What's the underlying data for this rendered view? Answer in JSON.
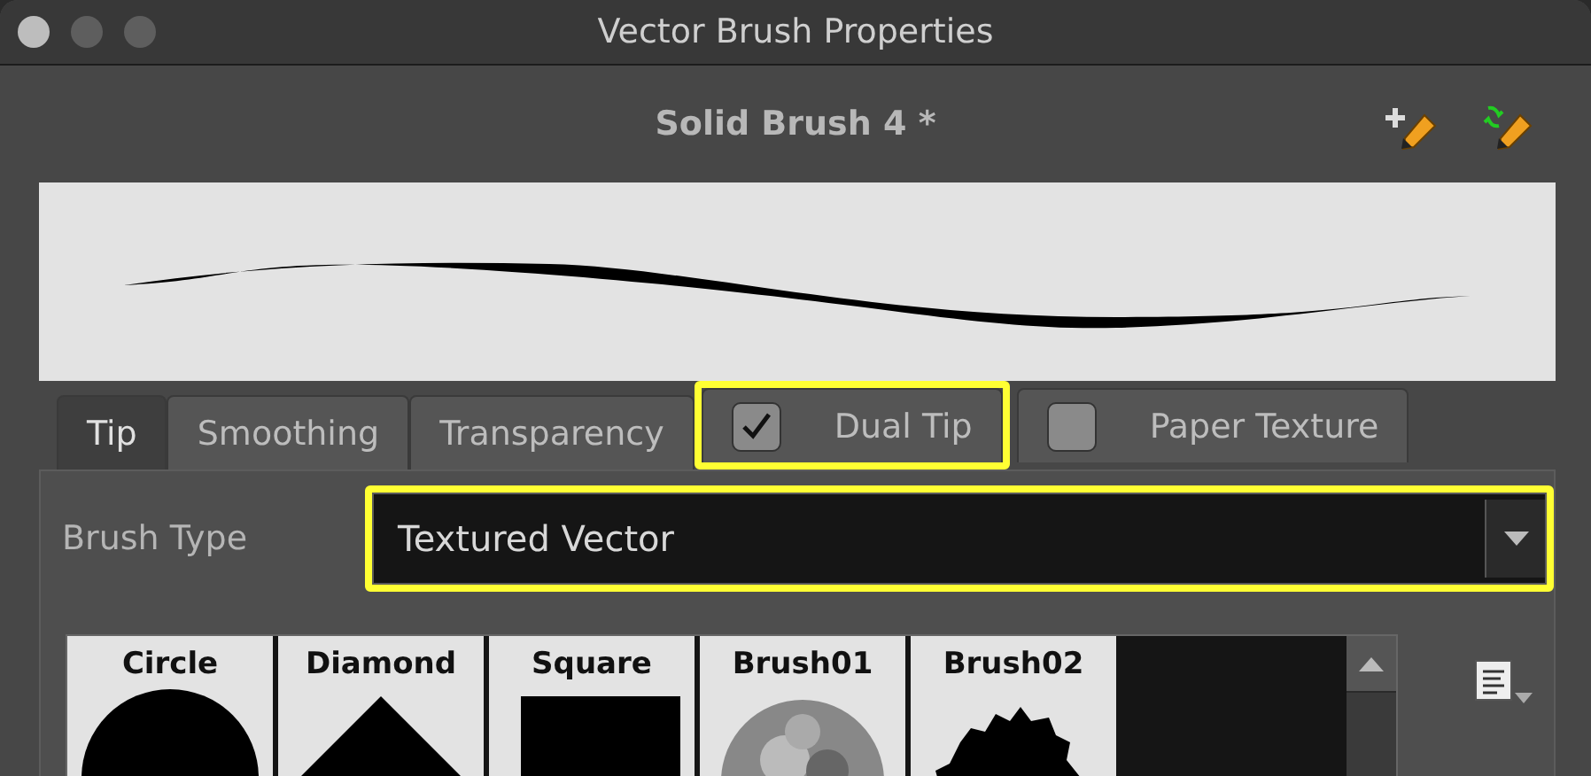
{
  "window": {
    "title": "Vector Brush Properties"
  },
  "brush_name": "Solid Brush 4 *",
  "tabs": [
    {
      "label": "Tip",
      "kind": "plain",
      "selected": true
    },
    {
      "label": "Smoothing",
      "kind": "plain",
      "selected": false
    },
    {
      "label": "Transparency",
      "kind": "plain",
      "selected": false
    },
    {
      "label": "Dual Tip",
      "kind": "checkbox",
      "checked": true,
      "selected": false,
      "highlighted": true
    },
    {
      "label": "Paper Texture",
      "kind": "checkbox",
      "checked": false,
      "selected": false,
      "highlighted": false
    }
  ],
  "brush_type": {
    "label": "Brush Type",
    "value": "Textured Vector",
    "highlighted": true
  },
  "tips": [
    {
      "label": "Circle",
      "kind": "circle"
    },
    {
      "label": "Diamond",
      "kind": "diamond"
    },
    {
      "label": "Square",
      "kind": "square"
    },
    {
      "label": "Brush01",
      "kind": "textured"
    },
    {
      "label": "Brush02",
      "kind": "splatter"
    }
  ]
}
